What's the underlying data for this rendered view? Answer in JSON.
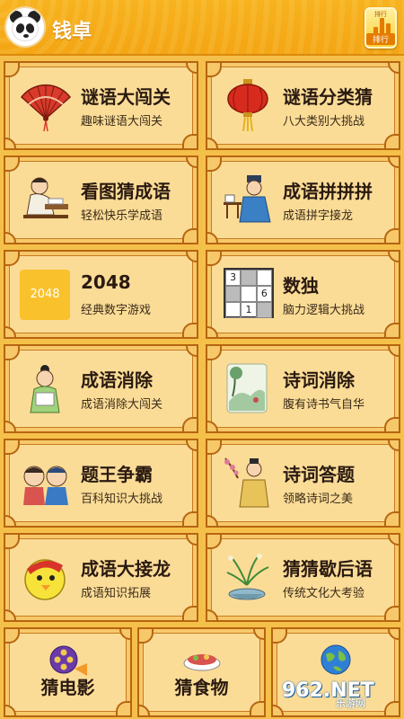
{
  "header": {
    "title": "钱卓",
    "rank_small": "排行",
    "rank_label": "排行"
  },
  "cards": [
    {
      "title": "谜语大闯关",
      "sub": "趣味谜语大闯关",
      "icon": "fan-icon"
    },
    {
      "title": "谜语分类猜",
      "sub": "八大类别大挑战",
      "icon": "lantern-icon"
    },
    {
      "title": "看图猜成语",
      "sub": "轻松快乐学成语",
      "icon": "scholar-reading-icon"
    },
    {
      "title": "成语拼拼拼",
      "sub": "成语拼字接龙",
      "icon": "scholar-sitting-icon"
    },
    {
      "title": "2048",
      "sub": "经典数字游戏",
      "icon": "tile-2048-icon",
      "tile": "2048"
    },
    {
      "title": "数独",
      "sub": "脑力逻辑大挑战",
      "icon": "sudoku-icon",
      "digits": [
        "3",
        "6",
        "1"
      ]
    },
    {
      "title": "成语消除",
      "sub": "成语消除大闯关",
      "icon": "child-with-book-icon"
    },
    {
      "title": "诗词消除",
      "sub": "腹有诗书气自华",
      "icon": "landscape-painting-icon"
    },
    {
      "title": "题王争霸",
      "sub": "百科知识大挑战",
      "icon": "two-kids-icon"
    },
    {
      "title": "诗词答题",
      "sub": "领略诗词之美",
      "icon": "poet-with-branch-icon"
    },
    {
      "title": "成语大接龙",
      "sub": "成语知识拓展",
      "icon": "yellow-chick-icon"
    },
    {
      "title": "猜猜歇后语",
      "sub": "传统文化大考验",
      "icon": "orchid-pot-icon"
    }
  ],
  "bottom": [
    {
      "title": "猜电影",
      "icon": "film-reel-icon"
    },
    {
      "title": "猜食物",
      "icon": "food-bowl-icon"
    },
    {
      "title": "",
      "icon": "globe-icon"
    }
  ],
  "watermark": {
    "num": "962.NET",
    "site": "乐游网"
  },
  "colors": {
    "header": "#f4a514",
    "card_bg": "#fbdc97",
    "border": "#b66511",
    "page_bg": "#f5c04a"
  }
}
